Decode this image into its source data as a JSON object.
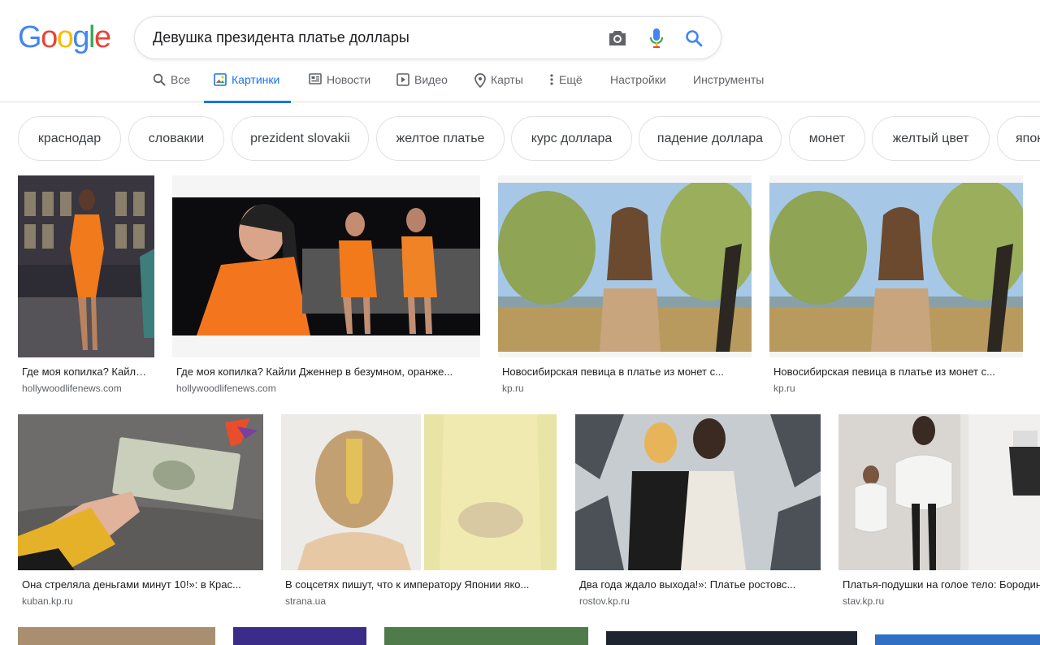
{
  "logo": {
    "letters": [
      "G",
      "o",
      "o",
      "g",
      "l",
      "e"
    ],
    "colors": [
      "#4285f4",
      "#ea4335",
      "#fbbc05",
      "#4285f4",
      "#34a853",
      "#ea4335"
    ]
  },
  "search": {
    "query": "Девушка президента платье доллары"
  },
  "icons": {
    "camera": "camera-icon",
    "mic": "microphone-icon",
    "search": "search-icon"
  },
  "tabs": [
    {
      "label": "Все",
      "icon": "search-icon"
    },
    {
      "label": "Картинки",
      "icon": "image-icon",
      "active": true
    },
    {
      "label": "Новости",
      "icon": "news-icon"
    },
    {
      "label": "Видео",
      "icon": "video-icon"
    },
    {
      "label": "Карты",
      "icon": "map-pin-icon"
    },
    {
      "label": "Ещё",
      "icon": "more-vert-icon"
    },
    {
      "label": "Настройки"
    },
    {
      "label": "Инструменты"
    }
  ],
  "chips": [
    "краснодар",
    "словакии",
    "prezident slovakii",
    "желтое платье",
    "курс доллара",
    "падение доллара",
    "монет",
    "желтый цвет",
    "японии"
  ],
  "results": [
    {
      "title": "Где моя копилка? Кайли ...",
      "source": "hollywoodlifenews.com"
    },
    {
      "title": "Где моя копилка? Кайли Дженнер в безумном, оранже...",
      "source": "hollywoodlifenews.com"
    },
    {
      "title": "Новосибирская певица в платье из монет с...",
      "source": "kp.ru"
    },
    {
      "title": "Новосибирская певица в платье из монет с...",
      "source": "kp.ru"
    },
    {
      "title": "Она стреляла деньгами минут 10!»: в Крас...",
      "source": "kuban.kp.ru"
    },
    {
      "title": "В соцсетях пишут, что к императору Японии яко...",
      "source": "strana.ua"
    },
    {
      "title": "Два года ждало выхода!»: Платье ростовс...",
      "source": "rostov.kp.ru"
    },
    {
      "title": "Платья-подушки на голое тело: Бородина",
      "source": "stav.kp.ru"
    }
  ],
  "colors": {
    "accent": "#1a73e8",
    "chipBorder": "#dfe1e5",
    "secondaryText": "#5f6368"
  }
}
